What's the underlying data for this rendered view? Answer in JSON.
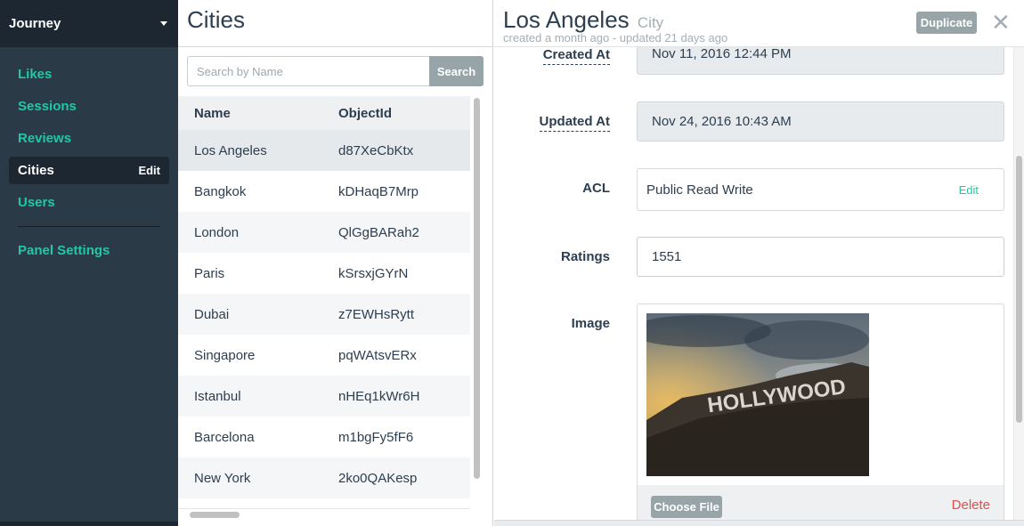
{
  "sidebar": {
    "app_name": "Journey",
    "items": [
      {
        "label": "Likes"
      },
      {
        "label": "Sessions"
      },
      {
        "label": "Reviews"
      },
      {
        "label": "Cities",
        "edit": "Edit"
      },
      {
        "label": "Users"
      }
    ],
    "panel_settings": "Panel Settings"
  },
  "list": {
    "title": "Cities",
    "search_placeholder": "Search by Name",
    "search_button": "Search",
    "columns": [
      "Name",
      "ObjectId"
    ],
    "rows": [
      {
        "name": "Los Angeles",
        "id": "d87XeCbKtx"
      },
      {
        "name": "Bangkok",
        "id": "kDHaqB7Mrp"
      },
      {
        "name": "London",
        "id": "QlGgBARah2"
      },
      {
        "name": "Paris",
        "id": "kSrsxjGYrN"
      },
      {
        "name": "Dubai",
        "id": "z7EWHsRytt"
      },
      {
        "name": "Singapore",
        "id": "pqWAtsvERx"
      },
      {
        "name": "Istanbul",
        "id": "nHEq1kWr6H"
      },
      {
        "name": "Barcelona",
        "id": "m1bgFy5fF6"
      },
      {
        "name": "New York",
        "id": "2ko0QAKesp"
      }
    ]
  },
  "detail": {
    "title": "Los Angeles",
    "class_name": "City",
    "subtitle": "created a month ago - updated 21 days ago",
    "duplicate_button": "Duplicate",
    "fields": {
      "created_at_label": "Created At",
      "created_at_value": "Nov 11, 2016 12:44 PM",
      "updated_at_label": "Updated At",
      "updated_at_value": "Nov 24, 2016 10:43 AM",
      "acl_label": "ACL",
      "acl_value": "Public Read Write",
      "acl_edit": "Edit",
      "ratings_label": "Ratings",
      "ratings_value": "1551",
      "image_label": "Image",
      "image_text": "HOLLYWOOD",
      "choose_file": "Choose File",
      "delete": "Delete"
    }
  }
}
